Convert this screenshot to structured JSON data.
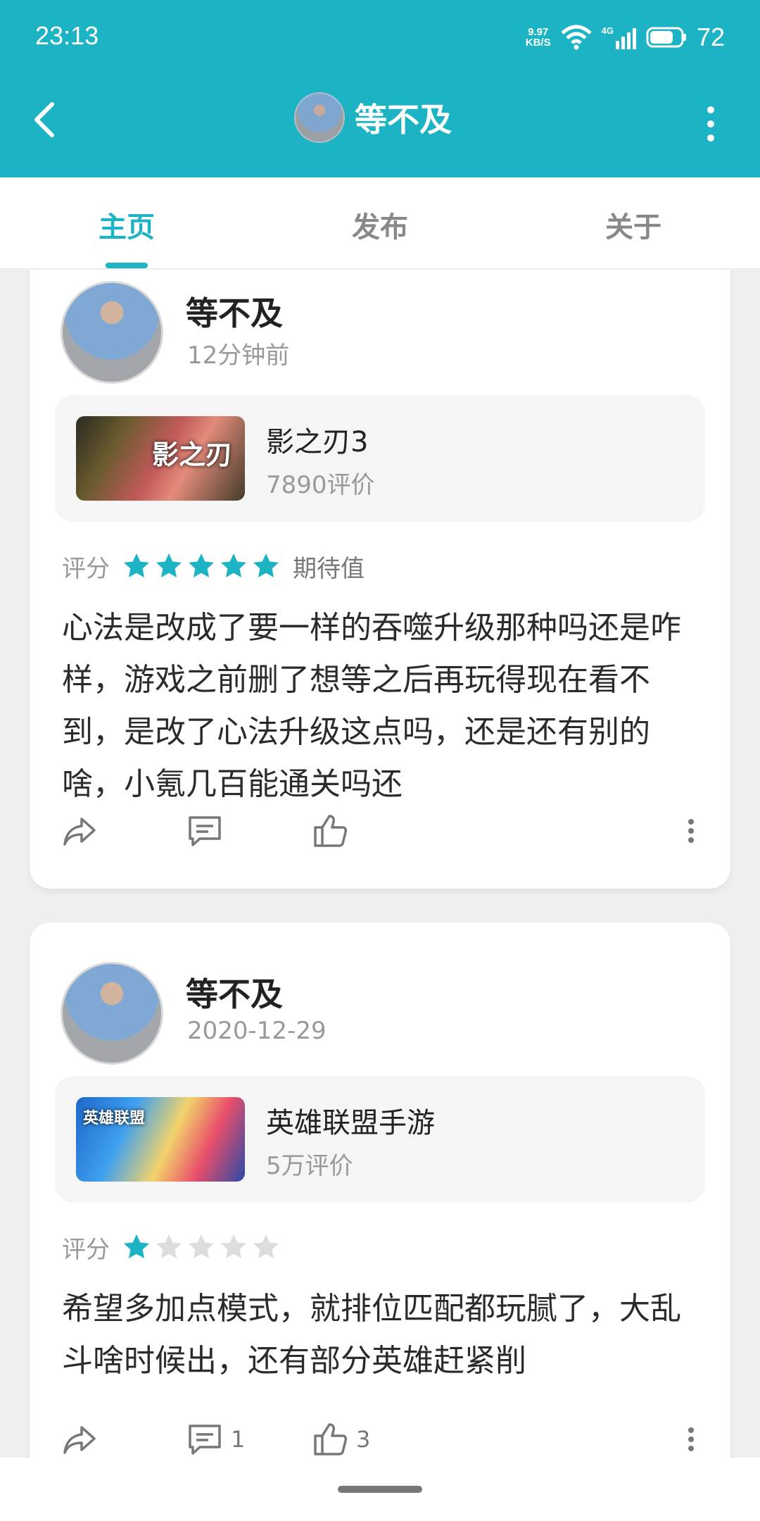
{
  "status_bar": {
    "time": "23:13",
    "net_speed_value": "9.97",
    "net_speed_unit": "KB/S",
    "network_type": "4G",
    "battery": "72"
  },
  "header": {
    "title": "等不及",
    "back_icon": "back-arrow-icon",
    "more_icon": "more-vertical-icon"
  },
  "tabs": [
    {
      "label": "主页",
      "active": true
    },
    {
      "label": "发布",
      "active": false
    },
    {
      "label": "关于",
      "active": false
    }
  ],
  "reviews": [
    {
      "username": "等不及",
      "time": "12分钟前",
      "game": {
        "name": "影之刃3",
        "reviews": "7890评价",
        "thumb_text": "影之刃"
      },
      "rating_label": "评分",
      "stars": 5,
      "rating_extra": "期待值",
      "content": "心法是改成了要一样的吞噬升级那种吗还是咋样，游戏之前删了想等之后再玩得现在看不到，是改了心法升级这点吗，还是还有别的啥，小氪几百能通关吗还",
      "comment_count": "",
      "like_count": ""
    },
    {
      "username": "等不及",
      "time": "2020-12-29",
      "game": {
        "name": "英雄联盟手游",
        "reviews": "5万评价",
        "thumb_text": "英雄联盟"
      },
      "rating_label": "评分",
      "stars": 1,
      "rating_extra": "",
      "content": "希望多加点模式，就排位匹配都玩腻了，大乱斗啥时候出，还有部分英雄赶紧削",
      "comment_count": "1",
      "like_count": "3"
    }
  ],
  "colors": {
    "accent": "#1cb3c4",
    "star_empty": "#dddddd"
  }
}
